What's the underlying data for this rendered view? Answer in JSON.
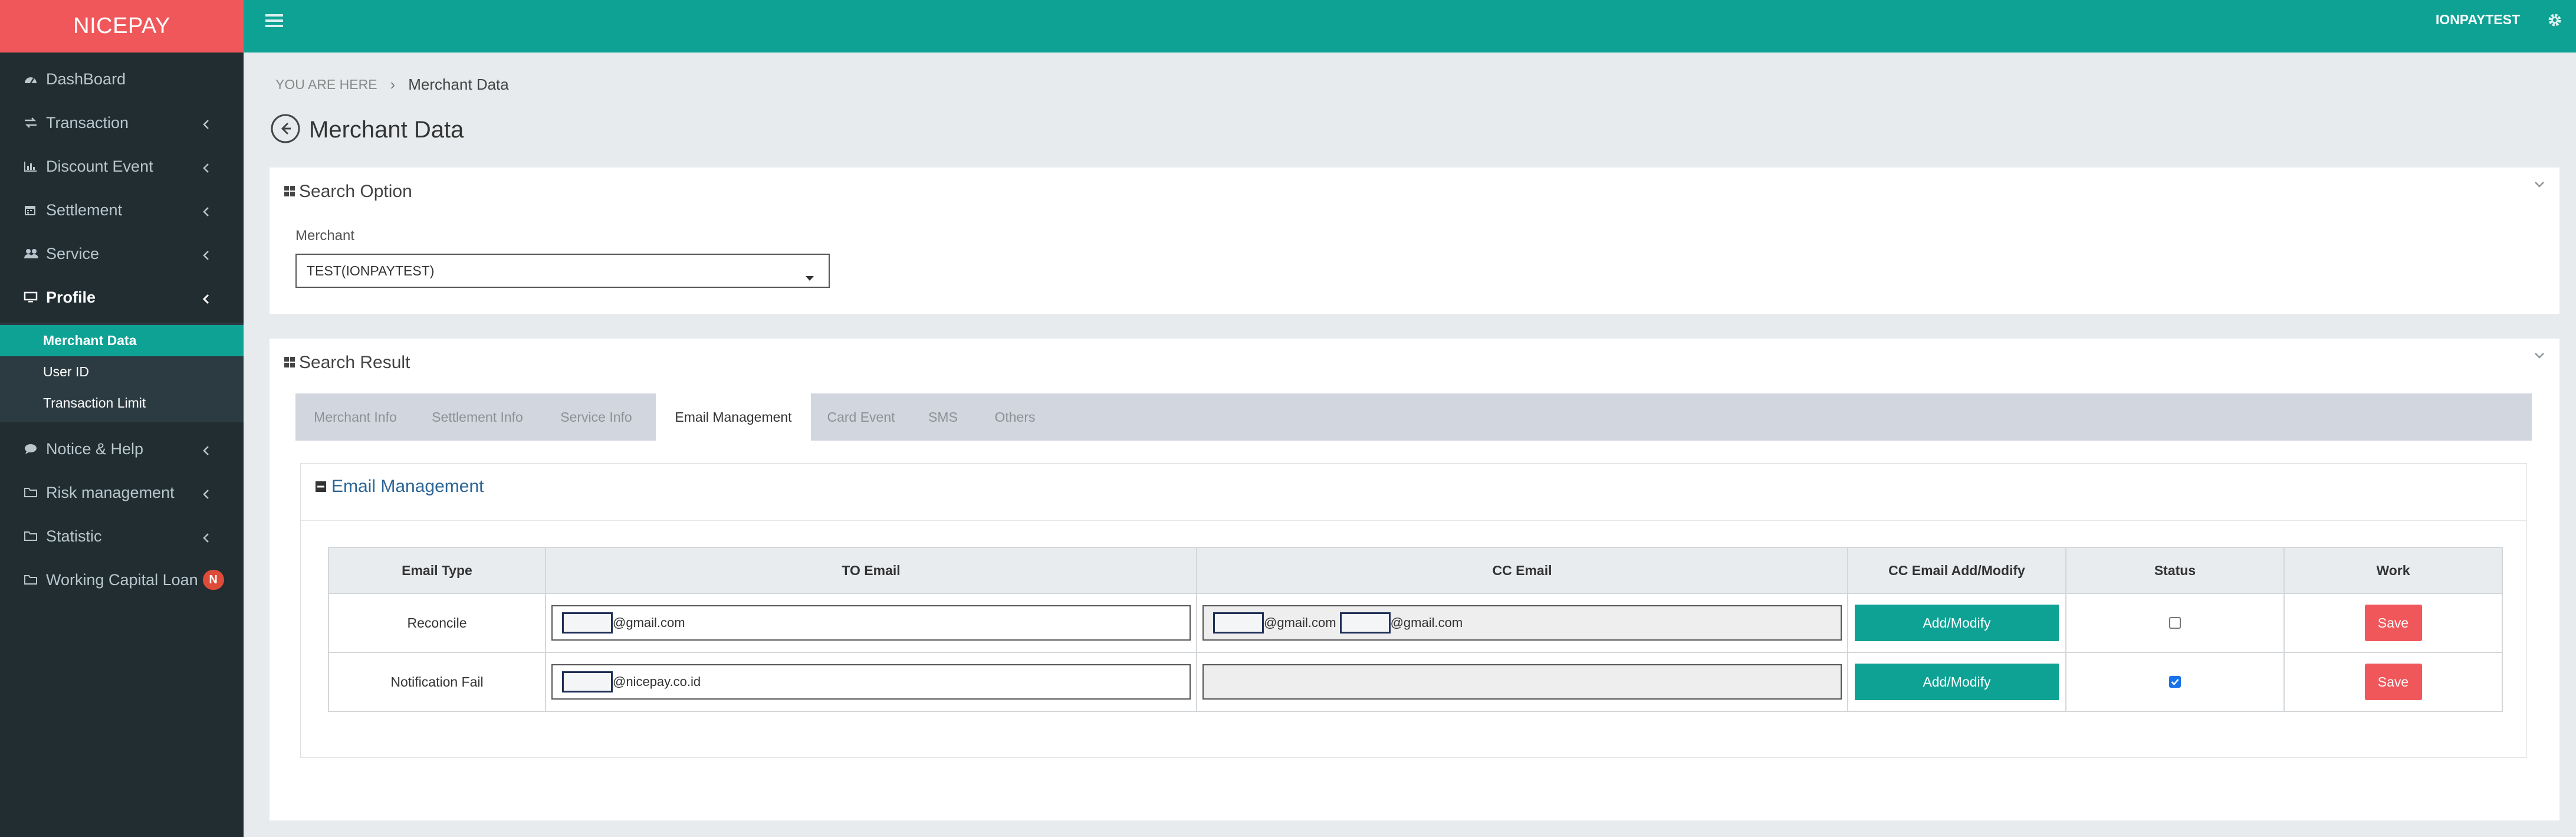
{
  "app": {
    "brand": "NICEPAY"
  },
  "sidebar": {
    "items": [
      {
        "label": "DashBoard",
        "icon": "dashboard-icon"
      },
      {
        "label": "Transaction",
        "icon": "exchange-icon"
      },
      {
        "label": "Discount Event",
        "icon": "bar-chart-icon"
      },
      {
        "label": "Settlement",
        "icon": "calendar-icon"
      },
      {
        "label": "Service",
        "icon": "users-icon"
      },
      {
        "label": "Profile",
        "icon": "monitor-icon"
      },
      {
        "label": "Notice & Help",
        "icon": "comment-icon"
      },
      {
        "label": "Risk management",
        "icon": "folder-icon"
      },
      {
        "label": "Statistic",
        "icon": "folder-icon"
      },
      {
        "label": "Working Capital Loan",
        "icon": "folder-icon",
        "badge": "N"
      }
    ],
    "profile_sub": [
      "Merchant Data",
      "User ID",
      "Transaction Limit"
    ],
    "active_item": "Profile",
    "active_sub": "Merchant Data"
  },
  "topbar": {
    "user": "IONPAYTEST"
  },
  "breadcrumb": {
    "prefix": "YOU ARE HERE",
    "current": "Merchant Data"
  },
  "page": {
    "title": "Merchant Data"
  },
  "search_option": {
    "title": "Search Option",
    "merchant_label": "Merchant",
    "merchant_value": "TEST(IONPAYTEST)"
  },
  "search_result": {
    "title": "Search Result",
    "tabs": [
      "Merchant Info",
      "Settlement Info",
      "Service Info",
      "Email Management",
      "Card Event",
      "SMS",
      "Others"
    ],
    "active_tab": "Email Management",
    "email_box_title": "Email Management",
    "table": {
      "headers": [
        "Email Type",
        "TO Email",
        "CC Email",
        "CC Email Add/Modify",
        "Status",
        "Work"
      ],
      "rows": [
        {
          "type": "Reconcile",
          "to_suffix": "@gmail.com",
          "cc1_suffix": "@gmail.com",
          "cc2_suffix": "@gmail.com",
          "button": "Add/Modify",
          "status_checked": false,
          "work": "Save"
        },
        {
          "type": "Notification Fail",
          "to_suffix": "@nicepay.co.id",
          "button": "Add/Modify",
          "status_checked": true,
          "work": "Save"
        }
      ]
    }
  },
  "colors": {
    "brand": "#f0575a",
    "accent": "#0ea295",
    "sidebar": "#222d32",
    "link": "#2a6496"
  }
}
